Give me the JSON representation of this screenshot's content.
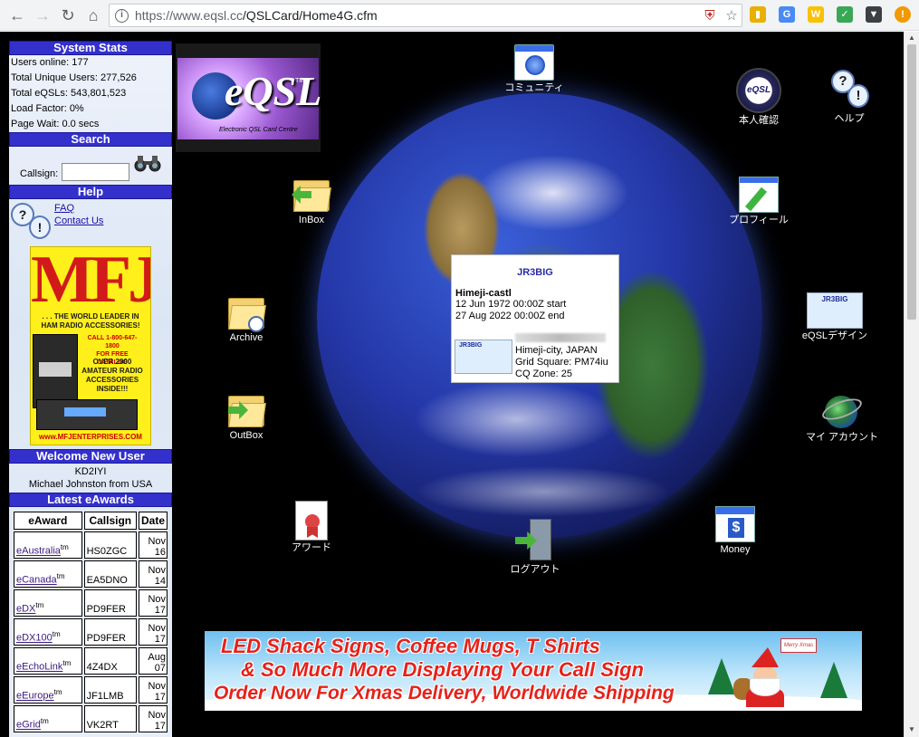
{
  "browser": {
    "url_host": "https://www.eqsl.cc",
    "url_path": "/QSLCard/Home4G.cfm",
    "info_glyph": "i"
  },
  "sidebar": {
    "system_stats_title": "System Stats",
    "stats": [
      "Users online: 177",
      "Total Unique Users: 277,526",
      "Total eQSLs: 543,801,523",
      "Load Factor: 0%",
      "Page Wait: 0.0 secs"
    ],
    "search_title": "Search",
    "callsign_label": "Callsign:",
    "callsign_value": "",
    "help_title": "Help",
    "help_links": [
      "FAQ",
      "Contact Us"
    ],
    "welcome_title": "Welcome New User",
    "welcome_call": "KD2IYI",
    "welcome_name": "Michael Johnston from USA",
    "awards_title": "Latest eAwards",
    "awards_headers": [
      "eAward",
      "Callsign",
      "Date"
    ],
    "awards_rows": [
      {
        "award": "eAustralia",
        "sup": "tm",
        "call": "HS0ZGC",
        "month": "Nov",
        "day": "16"
      },
      {
        "award": "eCanada",
        "sup": "tm",
        "call": "EA5DNO",
        "month": "Nov",
        "day": "14"
      },
      {
        "award": "eDX",
        "sup": "tm",
        "call": "PD9FER",
        "month": "Nov",
        "day": "17"
      },
      {
        "award": "eDX100",
        "sup": "tm",
        "call": "PD9FER",
        "month": "Nov",
        "day": "17"
      },
      {
        "award": "eEchoLink",
        "sup": "tm",
        "call": "4Z4DX",
        "month": "Aug",
        "day": "07"
      },
      {
        "award": "eEurope",
        "sup": "tm",
        "call": "JF1LMB",
        "month": "Nov",
        "day": "17"
      },
      {
        "award": "eGrid",
        "sup": "tm",
        "call": "VK2RT",
        "month": "Nov",
        "day": "17"
      }
    ],
    "mfj_ad": {
      "logo": "MFJ",
      "tagline_1": ". . . THE WORLD LEADER IN",
      "tagline_2": "HAM RADIO ACCESSORIES!",
      "call_1": "CALL 1-800-647-1800",
      "call_2": "FOR FREE CATALOG",
      "over_1": "OVER 2000",
      "over_2": "AMATEUR RADIO",
      "over_3": "ACCESSORIES",
      "over_4": "INSIDE!!!",
      "url": "www.MFJENTERPRISES.COM"
    }
  },
  "logo": {
    "word": "eQSL",
    "tm": "TM",
    "sub": "Electronic QSL Card Centre"
  },
  "icons": {
    "community": "コミュニティ",
    "verify": "本人確認",
    "verify_badge": "eQSL",
    "help": "ヘルプ",
    "inbox": "InBox",
    "profile": "プロフィール",
    "archive": "Archive",
    "design": "eQSLデザイン",
    "design_card": "JR3BIG",
    "outbox": "OutBox",
    "account": "マイ アカウント",
    "award": "アワード",
    "money": "Money",
    "money_symbol": "$",
    "logout": "ログアウト"
  },
  "popup": {
    "callsign": "JR3BIG",
    "name": "Himeji-castl",
    "start": "12 Jun 1972 00:00Z start",
    "end": "27 Aug 2022 00:00Z end",
    "card_label": "JR3BIG",
    "city": "Himeji-city, JAPAN",
    "grid": "Grid Square: PM74iu",
    "cq": "CQ Zone: 25"
  },
  "banner": {
    "line1": "LED Shack Signs, Coffee Mugs, T Shirts",
    "line2": "& So Much More Displaying Your Call Sign",
    "line3": "Order Now For Xmas Delivery, Worldwide Shipping",
    "sign": "Merry Xmas"
  },
  "colors": {
    "sidebar_header": "#3330cc",
    "page_bg": "#000000",
    "banner_text": "#e6221a"
  }
}
